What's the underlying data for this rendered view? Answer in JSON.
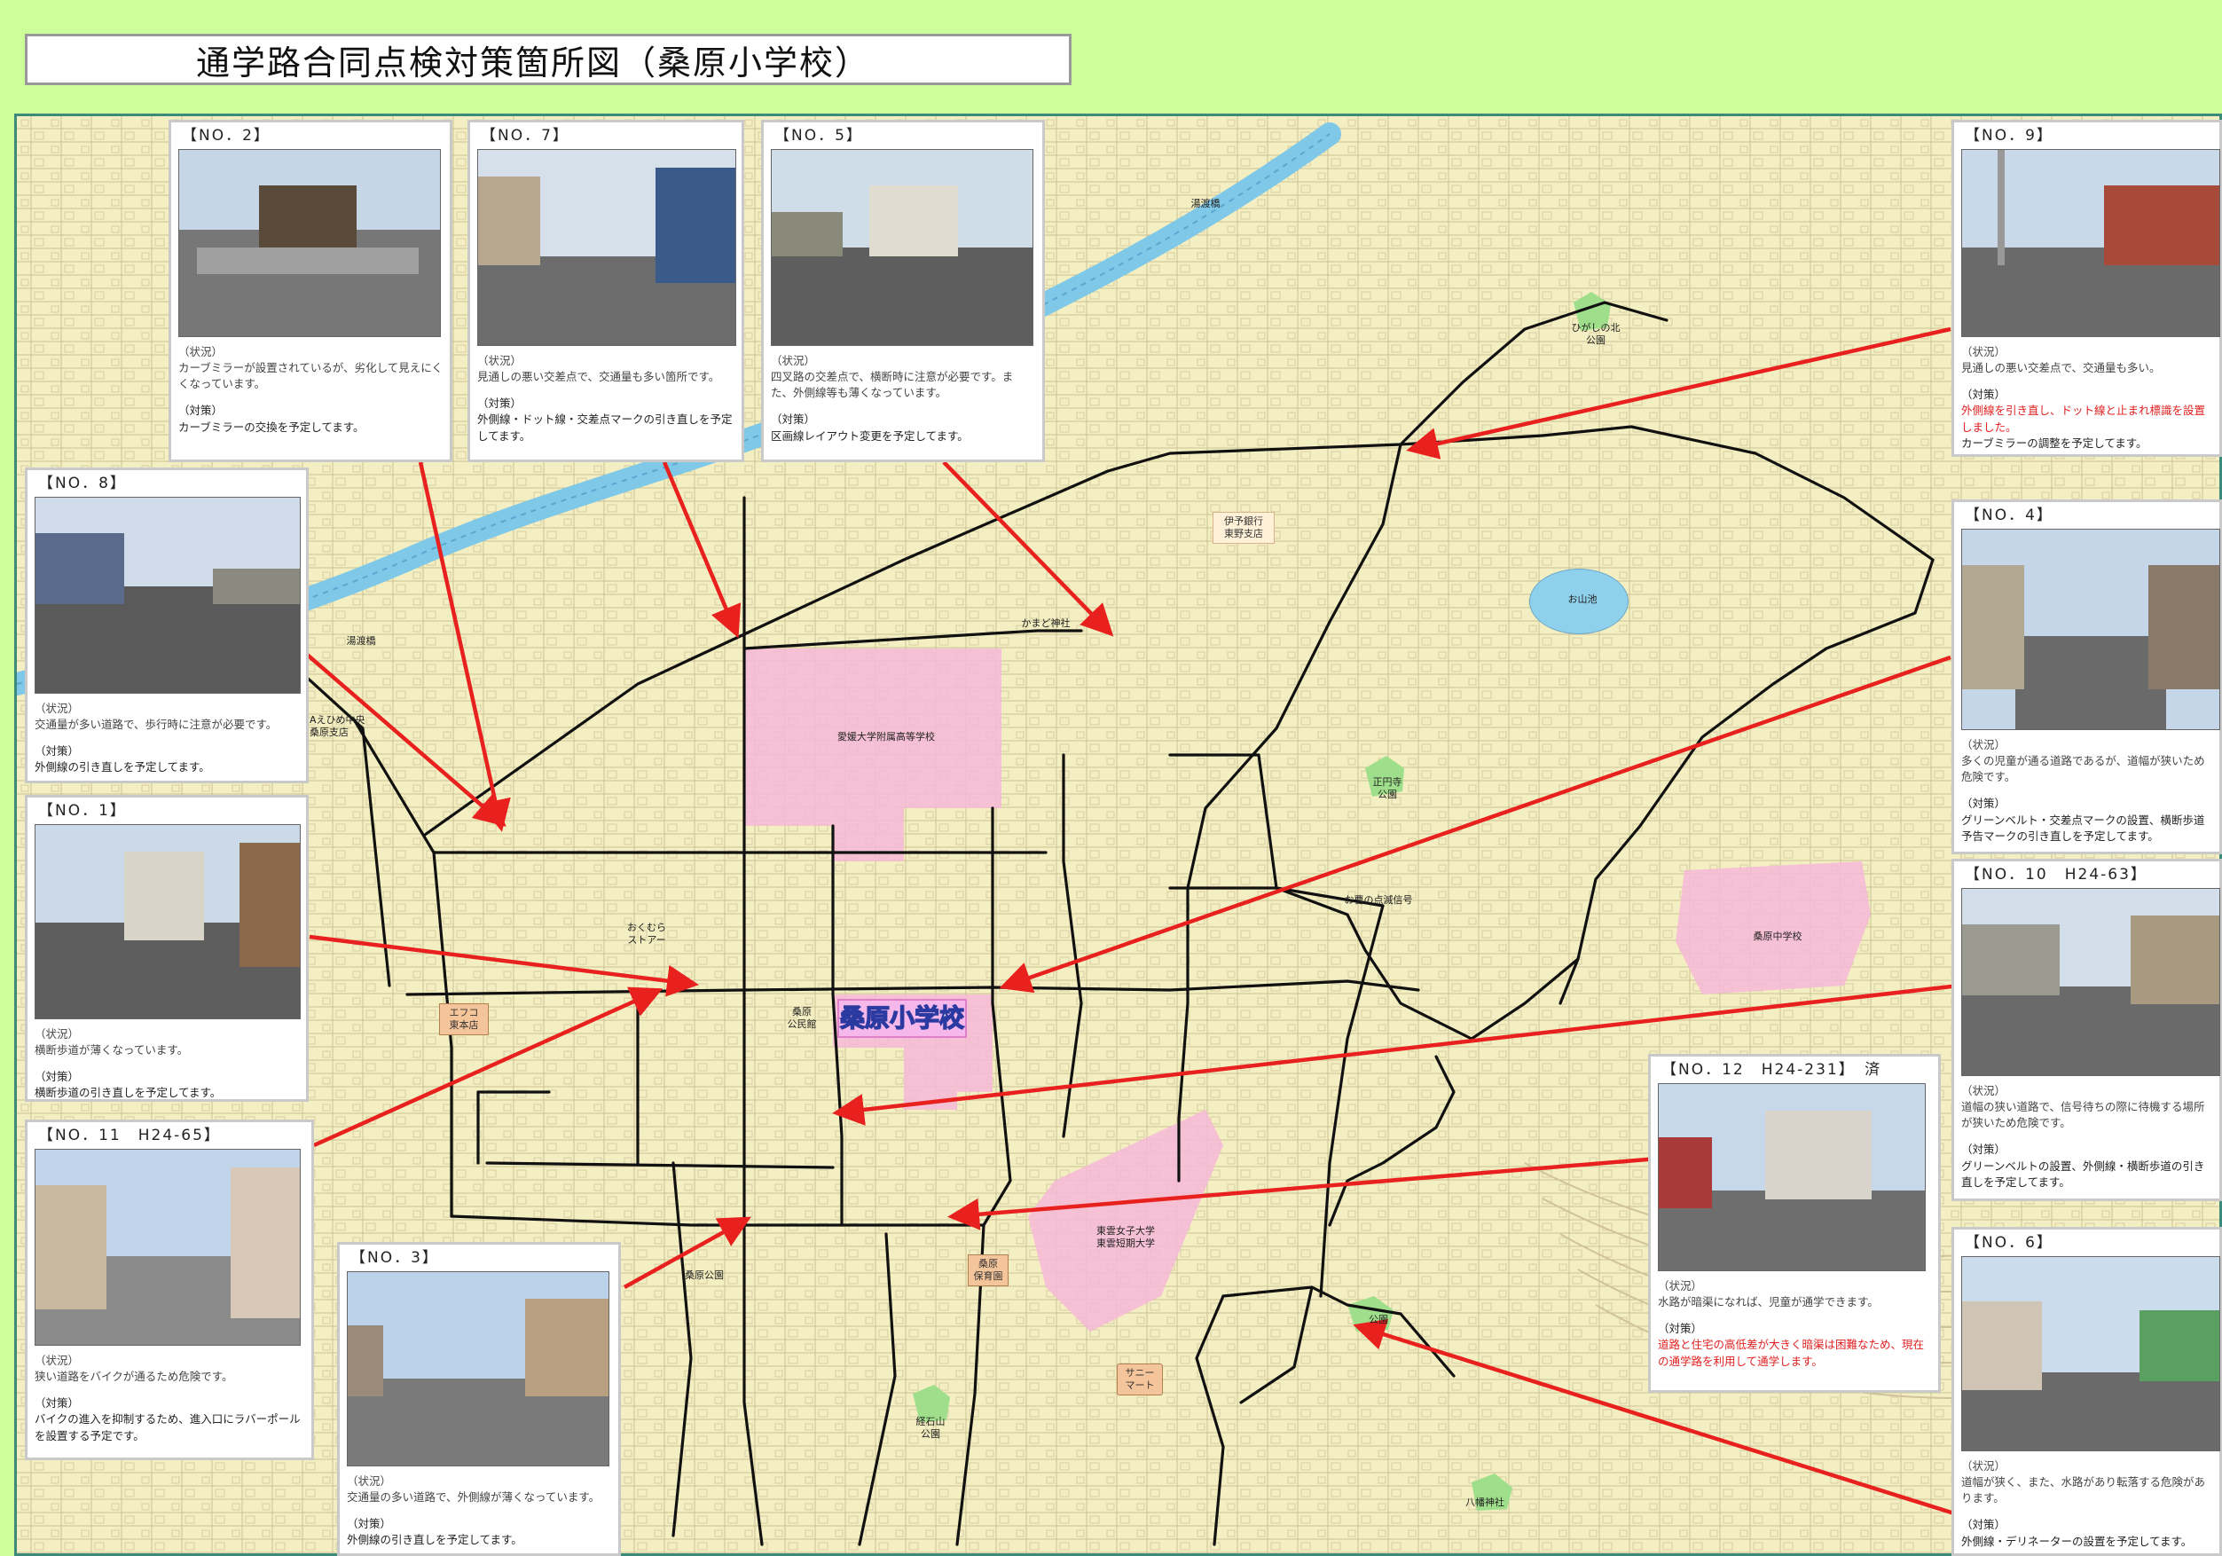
{
  "title": "通学路合同点検対策箇所図（桑原小学校）",
  "colors": {
    "page_bg": "#ccff99",
    "map_bg": "#f4efc2",
    "arrow": "#e8201e",
    "route": "#111111",
    "school_zone": "#f6b8d8",
    "park": "#9fde8a",
    "store": "#f4c49a",
    "river": "#7fc8e8"
  },
  "map_labels": {
    "main_school": "桑原小学校",
    "high_school": "愛媛大学附属高等学校",
    "junior_high": "桑原中学校",
    "university": "東雲女子大学\n東雲短期大学",
    "kamado": "かまど神社",
    "iyo_bank": "伊予銀行\n東野支店",
    "oyama_pond": "お山池",
    "higashinokita_park": "ひがしの北\n公園",
    "shoenji_park": "正円寺\n公園",
    "ehime_bank": "Aえひめ中央\n桑原支店",
    "okumura": "おくむら\nストアー",
    "efuko": "エフコ\n東本店",
    "kuwahara_hall": "桑原\n公民館",
    "kuwahara_park": "桑原公園",
    "kuwahara_nursery": "桑原\n保育園",
    "sunny_mart": "サニー\nマート",
    "kyozan_park": "経石山\n公園",
    "hachiman": "八幡神社",
    "park_se": "公園",
    "signal": "お曹の点滅信号",
    "bridge_left": "湯渡橋",
    "bridge_top": "湯渡橋"
  },
  "cards": {
    "no2": {
      "no": "【NO．2】",
      "status_label": "（状況）",
      "status": "カーブミラーが設置されているが、劣化して見えにくくなっています。",
      "measure_label": "（対策）",
      "measure": "カーブミラーの交換を予定してます。",
      "measure_red": ""
    },
    "no7": {
      "no": "【NO．7】",
      "status_label": "（状況）",
      "status": "見通しの悪い交差点で、交通量も多い箇所です。",
      "measure_label": "（対策）",
      "measure": "外側線・ドット線・交差点マークの引き直しを予定してます。",
      "measure_red": ""
    },
    "no5": {
      "no": "【NO．5】",
      "status_label": "（状況）",
      "status": "四叉路の交差点で、横断時に注意が必要です。また、外側線等も薄くなっています。",
      "measure_label": "（対策）",
      "measure": "区画線レイアウト変更を予定してます。",
      "measure_red": ""
    },
    "no9": {
      "no": "【NO．9】",
      "status_label": "（状況）",
      "status": "見通しの悪い交差点で、交通量も多い。",
      "measure_label": "（対策）",
      "measure_red": "外側線を引き直し、ドット線と止まれ標識を設置しました。",
      "measure": "カーブミラーの調整を予定してます。"
    },
    "no8": {
      "no": "【NO．8】",
      "status_label": "（状況）",
      "status": "交通量が多い道路で、歩行時に注意が必要です。",
      "measure_label": "（対策）",
      "measure": "外側線の引き直しを予定してます。",
      "measure_red": ""
    },
    "no4": {
      "no": "【NO．4】",
      "status_label": "（状況）",
      "status": "多くの児童が通る道路であるが、道幅が狭いため危険です。",
      "measure_label": "（対策）",
      "measure": "グリーンベルト・交差点マークの設置、横断歩道予告マークの引き直しを予定してます。",
      "measure_red": ""
    },
    "no1": {
      "no": "【NO．1】",
      "status_label": "（状況）",
      "status": "横断歩道が薄くなっています。",
      "measure_label": "（対策）",
      "measure": "横断歩道の引き直しを予定してます。",
      "measure_red": ""
    },
    "no10": {
      "no": "【NO．10　H24-63】",
      "status_label": "（状況）",
      "status": "道幅の狭い道路で、信号待ちの際に待機する場所が狭いため危険です。",
      "measure_label": "（対策）",
      "measure": "グリーンベルトの設置、外側線・横断歩道の引き直しを予定してます。",
      "measure_red": ""
    },
    "no11": {
      "no": "【NO．11　H24-65】",
      "status_label": "（状況）",
      "status": "狭い道路をバイクが通るため危険です。",
      "measure_label": "（対策）",
      "measure": "バイクの進入を抑制するため、進入口にラバーポールを設置する予定です。",
      "measure_red": ""
    },
    "no12": {
      "no": "【NO．12　H24-231】　済",
      "status_label": "（状況）",
      "status": "水路が暗渠になれば、児童が通学できます。",
      "measure_label": "（対策）",
      "measure_red": "道路と住宅の高低差が大きく暗渠は困難なため、現在の通学路を利用して通学します。",
      "measure": ""
    },
    "no3": {
      "no": "【NO．3】",
      "status_label": "（状況）",
      "status": "交通量の多い道路で、外側線が薄くなっています。",
      "measure_label": "（対策）",
      "measure": "外側線の引き直しを予定してます。",
      "measure_red": ""
    },
    "no6": {
      "no": "【NO．6】",
      "status_label": "（状況）",
      "status": "道幅が狭く、また、水路があり転落する危険があります。",
      "measure_label": "（対策）",
      "measure": "外側線・デリネーターの設置を予定してます。",
      "measure_red": ""
    }
  }
}
